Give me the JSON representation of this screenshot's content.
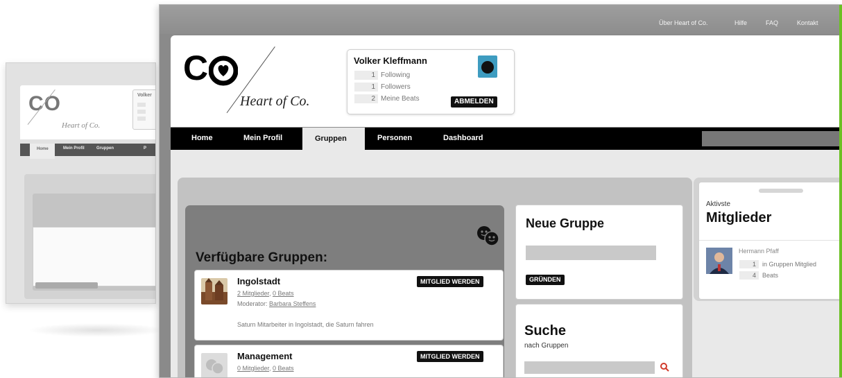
{
  "back_window": {
    "logo": "CO",
    "tagline": "Heart of Co.",
    "user_snippet": "Volker",
    "nav": [
      "Home",
      "Mein Profil",
      "Gruppen",
      "P"
    ]
  },
  "top_links": [
    "Über Heart of Co.",
    "Hilfe",
    "FAQ",
    "Kontakt"
  ],
  "logo": {
    "text": "CO",
    "tagline": "Heart of Co."
  },
  "user": {
    "name": "Volker Kleffmann",
    "stats": [
      {
        "value": "1",
        "label": "Following"
      },
      {
        "value": "1",
        "label": "Followers"
      },
      {
        "value": "2",
        "label": "Meine Beats"
      }
    ],
    "logout_label": "ABMELDEN"
  },
  "nav": {
    "tabs": [
      "Home",
      "Mein Profil",
      "Gruppen",
      "Personen",
      "Dashboard"
    ],
    "active": "Gruppen"
  },
  "groups": {
    "title": "Verfügbare Gruppen:",
    "items": [
      {
        "name": "Ingolstadt",
        "members": "2 Mitglieder",
        "beats": "0 Beats",
        "moderator_label": "Moderator:",
        "moderator": "Barbara Steffens",
        "description": "Saturn Mitarbeiter in Ingolstadt, die Saturn fahren",
        "join_label": "MITGLIED WERDEN"
      },
      {
        "name": "Management",
        "members": "0 Mitglieder",
        "beats": "0 Beats",
        "join_label": "MITGLIED WERDEN"
      }
    ]
  },
  "new_group": {
    "title": "Neue Gruppe",
    "button": "GRÜNDEN"
  },
  "search": {
    "title": "Suche",
    "subtitle": "nach Gruppen"
  },
  "members": {
    "top": "Aktivste",
    "title": "Mitglieder",
    "list": [
      {
        "name": "Hermann Pfaff",
        "stats": [
          {
            "value": "1",
            "label": "in Gruppen Mitglied"
          },
          {
            "value": "4",
            "label": "Beats"
          }
        ]
      }
    ]
  },
  "colors": {
    "accent_green": "#6cc024",
    "nav_bg": "#000000",
    "button_bg": "#111111"
  }
}
